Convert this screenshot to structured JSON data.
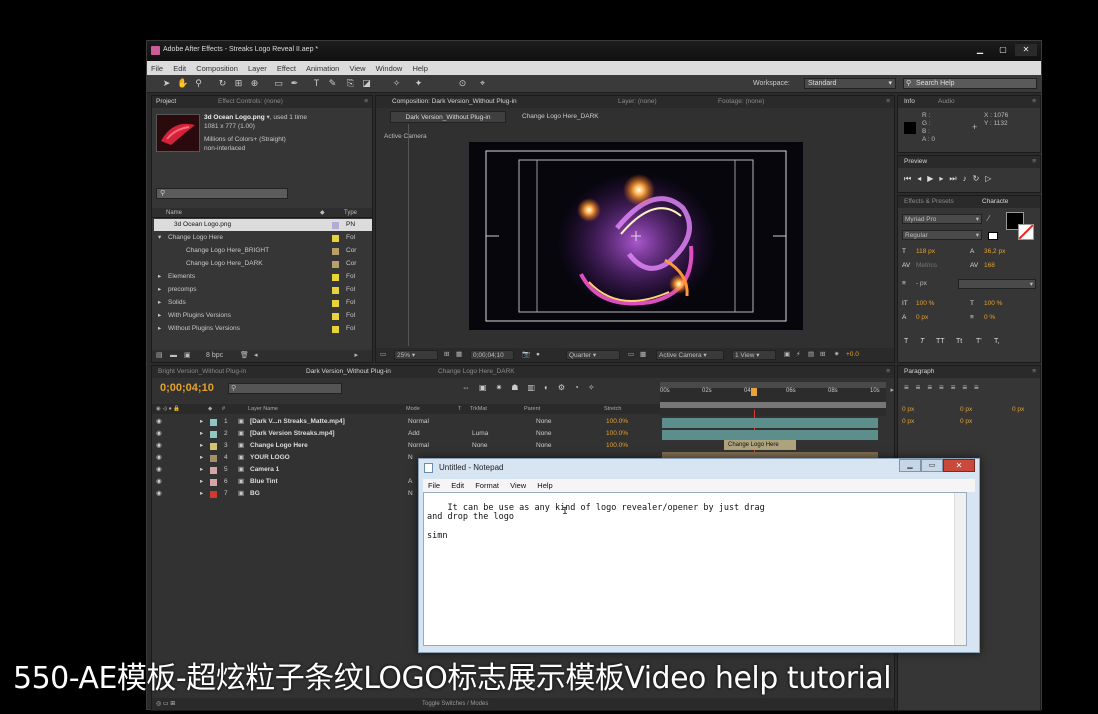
{
  "window": {
    "title": "Adobe After Effects - Streaks Logo Reveal II.aep *"
  },
  "menu": [
    "File",
    "Edit",
    "Composition",
    "Layer",
    "Effect",
    "Animation",
    "View",
    "Window",
    "Help"
  ],
  "toolbar": {
    "workspace_label": "Workspace:",
    "workspace_value": "Standard",
    "search_placeholder": "Search Help"
  },
  "project": {
    "tabs": [
      "Project",
      "Effect Controls: (none)"
    ],
    "file_name": "3d Ocean Logo.png",
    "file_used": ", used 1 time",
    "file_dims": "1081 x 777 (1.00)",
    "file_colors": "Millions of Colors+ (Straight)",
    "file_interlace": "non-interlaced",
    "col_name": "Name",
    "col_type": "Type",
    "items": [
      {
        "name": "3d Ocean Logo.png",
        "type": "PN",
        "color": "#b6a9d6"
      },
      {
        "name": "Change Logo Here",
        "type": "Fol",
        "color": "#e7d33a"
      },
      {
        "name": "Change Logo Here_BRIGHT",
        "type": "Cor",
        "color": "#b6a06a"
      },
      {
        "name": "Change Logo Here_DARK",
        "type": "Cor",
        "color": "#b6a06a"
      },
      {
        "name": "Elements",
        "type": "Fol",
        "color": "#e7d33a"
      },
      {
        "name": "precomps",
        "type": "Fol",
        "color": "#e7d33a"
      },
      {
        "name": "Solids",
        "type": "Fol",
        "color": "#e7d33a"
      },
      {
        "name": "With Plugins Versions",
        "type": "Fol",
        "color": "#e7d33a"
      },
      {
        "name": "Without Plugins Versions",
        "type": "Fol",
        "color": "#e7d33a"
      }
    ],
    "bpc": "8 bpc"
  },
  "comp": {
    "tabs": [
      "Composition: Dark Version_Without Plug-in",
      "Layer: (none)",
      "Footage: (none)"
    ],
    "subtabs": [
      "Dark Version_Without Plug-in",
      "Change Logo Here_DARK"
    ],
    "active_camera": "Active Camera",
    "zoom": "25%",
    "timecode": "0;00;04;10",
    "quality": "Quarter",
    "view_cam": "Active Camera",
    "view_count": "1 View",
    "exposure": "+0.0"
  },
  "info": {
    "tabs": [
      "Info",
      "Audio"
    ],
    "r": "R :",
    "g": "G :",
    "b": "B :",
    "a": "A : 0",
    "x": "X : 1076",
    "y": "Y : 1132"
  },
  "preview": {
    "title": "Preview"
  },
  "effects": {
    "tabs": [
      "Effects & Presets",
      "Characte"
    ]
  },
  "character": {
    "font": "Myriad Pro",
    "style": "Regular",
    "size": "118 px",
    "leading": "36,2 px",
    "kerning": "Metrics",
    "tracking": "168",
    "stroke": "- px",
    "vscale": "100 %",
    "hscale": "100 %",
    "baseline": "0 px",
    "tsume": "0 %",
    "styles": [
      "T",
      "T",
      "TT",
      "Tt",
      "T'",
      "T,"
    ]
  },
  "paragraph": {
    "title": "Paragraph",
    "indent1": "0 px",
    "indent2": "0 px",
    "indent3": "0 px",
    "space1": "0 px",
    "space2": "0 px"
  },
  "timeline": {
    "tabs": [
      "Bright Version_Without Plug-in",
      "Dark Version_Without Plug-in",
      "Change Logo Here_DARK"
    ],
    "timecode": "0;00;04;10",
    "col_layer": "Layer Name",
    "col_mode": "Mode",
    "col_t": "T",
    "col_trkmat": "TrkMat",
    "col_parent": "Parent",
    "col_stretch": "Stretch",
    "ruler": [
      "00s",
      "02s",
      "04s",
      "06s",
      "08s",
      "10s"
    ],
    "layers": [
      {
        "num": "1",
        "name": "[Dark V...n Streaks_Matte.mp4]",
        "mode": "Normal",
        "trk": "",
        "parent": "None",
        "stretch": "100.0%",
        "color": "#8fc7c2"
      },
      {
        "num": "2",
        "name": "[Dark Version Streaks.mp4]",
        "mode": "Add",
        "trk": "Luma",
        "parent": "None",
        "stretch": "100.0%",
        "color": "#8fc7c2"
      },
      {
        "num": "3",
        "name": "Change Logo Here",
        "mode": "Normal",
        "trk": "None",
        "parent": "None",
        "stretch": "100.0%",
        "color": "#d4c273"
      },
      {
        "num": "4",
        "name": "YOUR LOGO",
        "mode": "N",
        "trk": "",
        "parent": "",
        "stretch": "",
        "color": "#a48f6b"
      },
      {
        "num": "5",
        "name": "Camera 1",
        "mode": "",
        "trk": "",
        "parent": "",
        "stretch": "",
        "color": "#d4a6a6"
      },
      {
        "num": "6",
        "name": "Blue Tint",
        "mode": "A",
        "trk": "",
        "parent": "",
        "stretch": "",
        "color": "#d4a6a6"
      },
      {
        "num": "7",
        "name": "BG",
        "mode": "N",
        "trk": "",
        "parent": "",
        "stretch": "",
        "color": "#d03a2e"
      }
    ],
    "bar_label": "Change Logo Here",
    "footer": "Toggle Switches / Modes"
  },
  "notepad": {
    "title": "Untitled - Notepad",
    "menu": [
      "File",
      "Edit",
      "Format",
      "View",
      "Help"
    ],
    "text": "It can be use as any kind of logo revealer/opener by just drag\nand drop the logo\n\nsimn"
  },
  "caption": "550-AE模板-超炫粒子条纹LOGO标志展示模板Video help tutorial"
}
